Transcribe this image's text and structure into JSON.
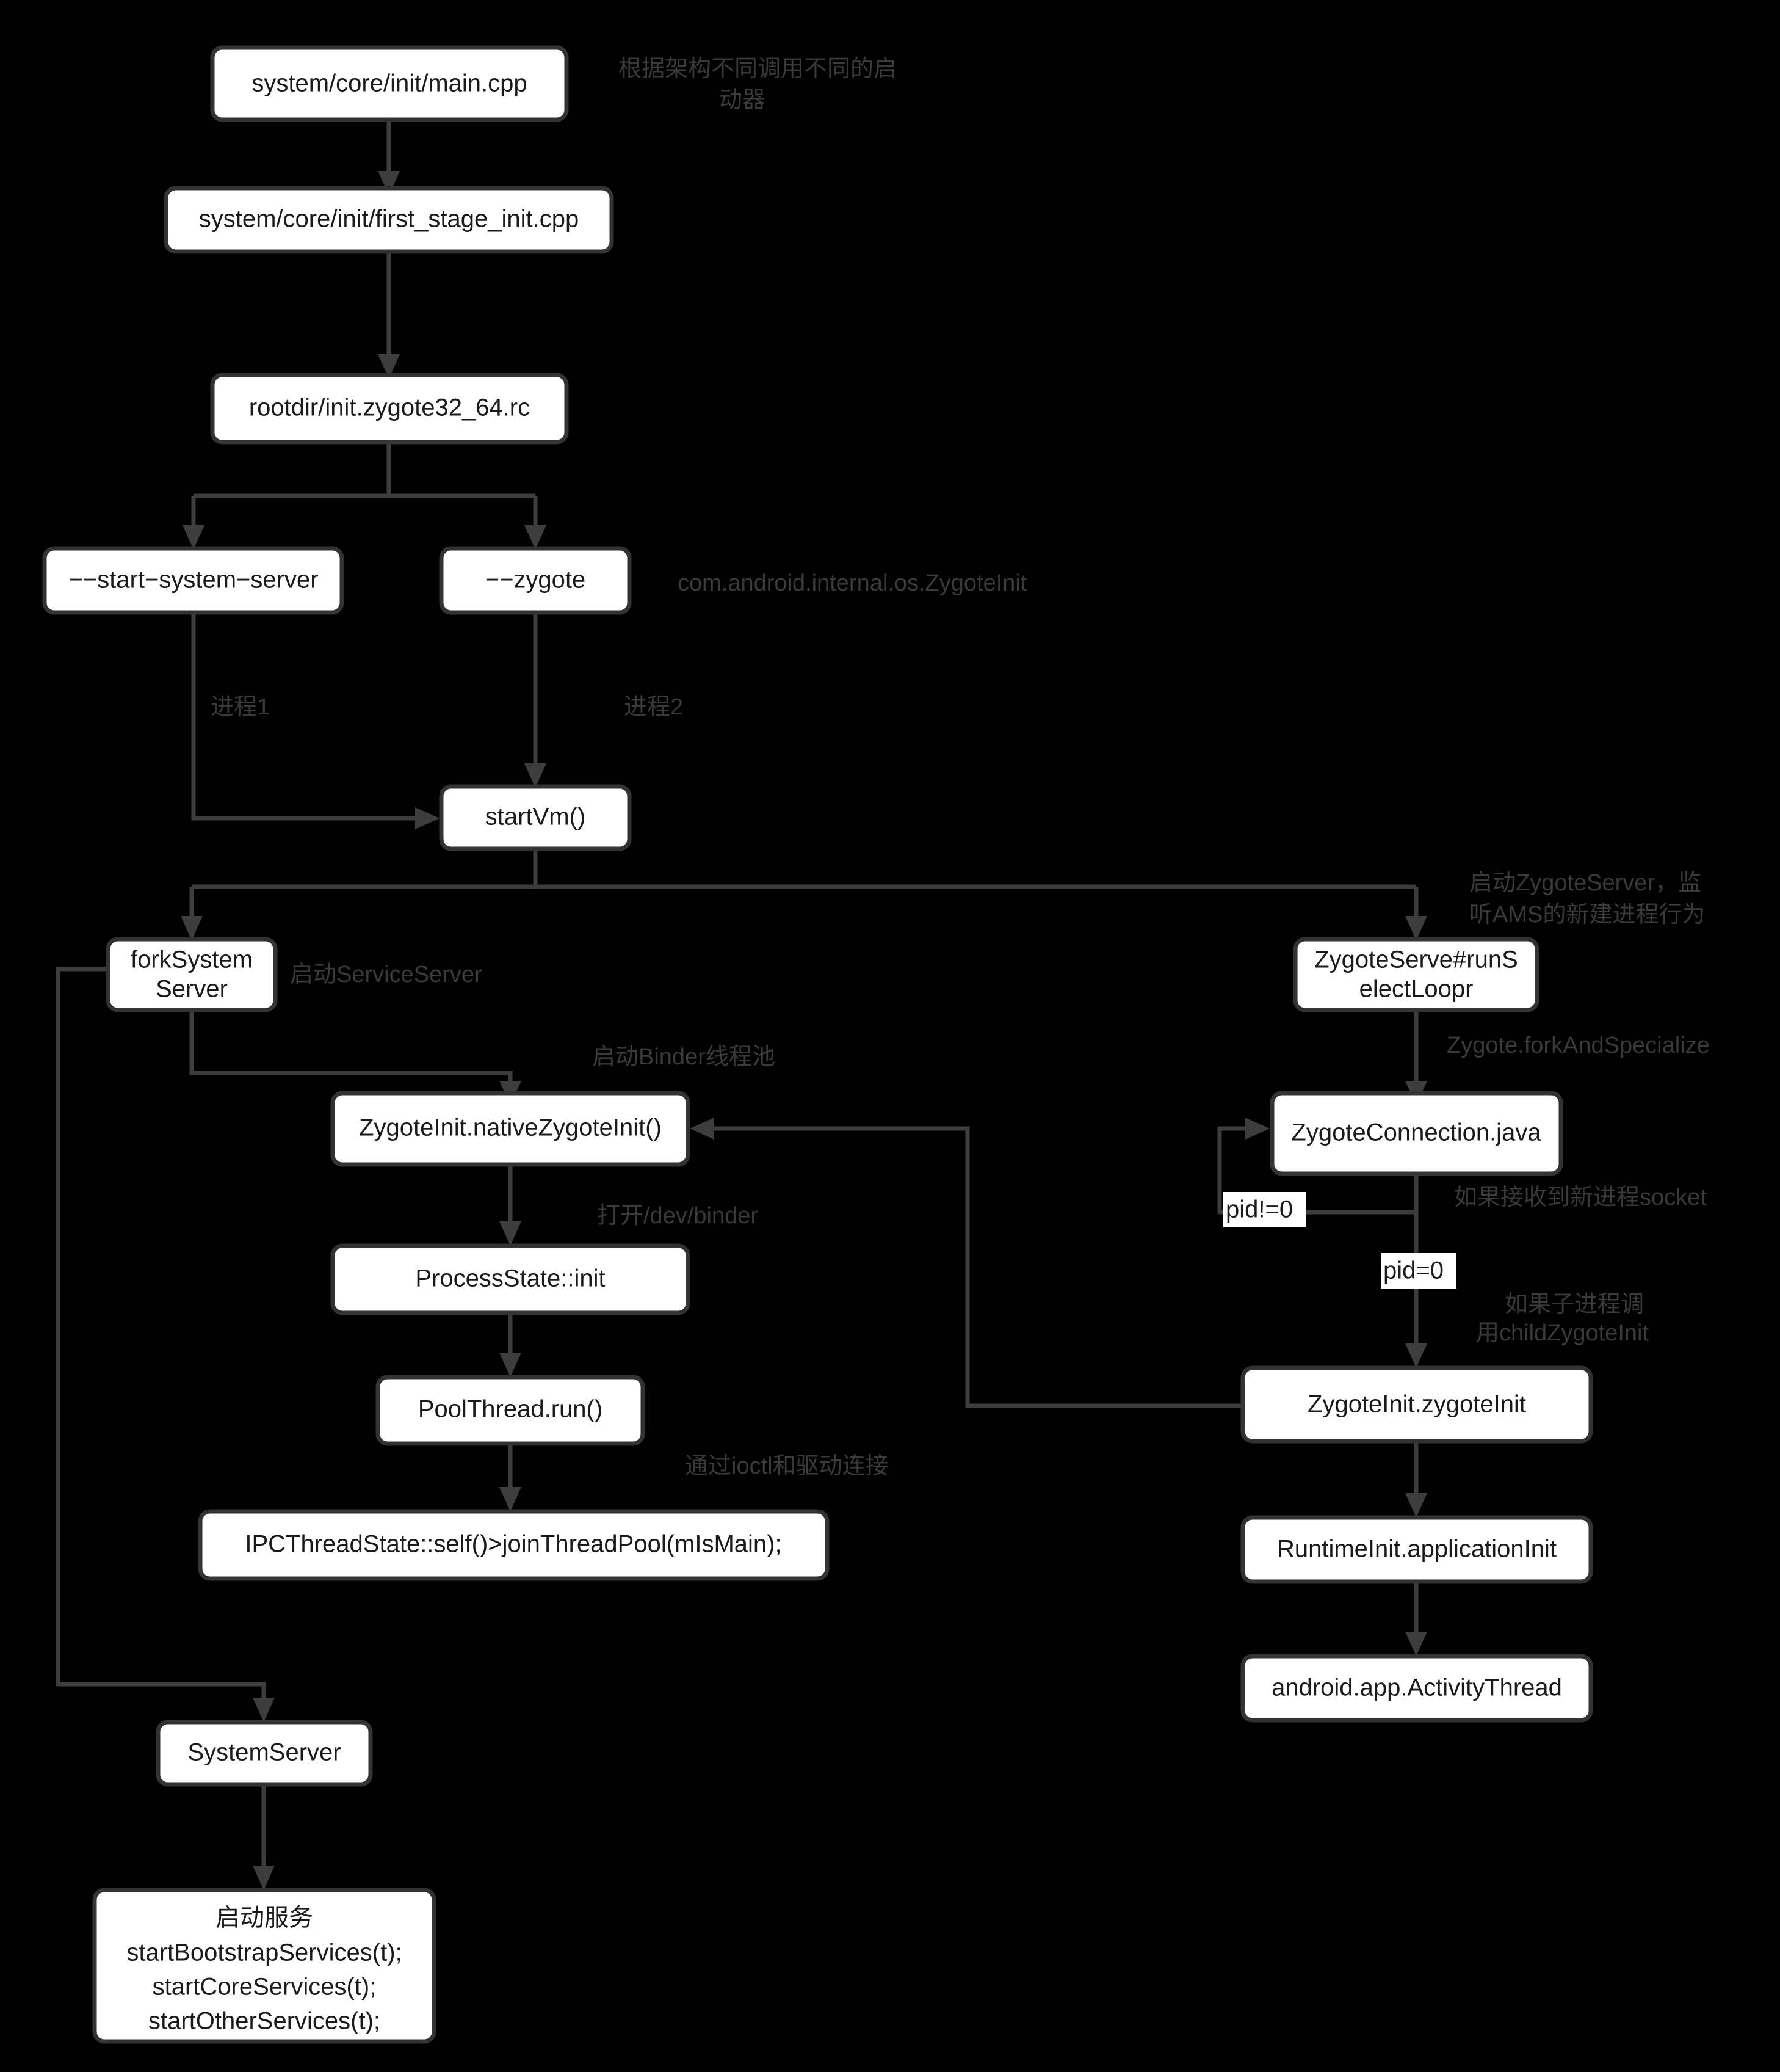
{
  "diagram": {
    "title": "Android Zygote / SystemServer startup flow",
    "background_color": "#000000",
    "node_fill": "#ffffff",
    "node_border": "#333333",
    "edge_color": "#3d3d3d",
    "edge_label_color": "#3a3a3a"
  },
  "nodes": {
    "main_cpp": {
      "label": "system/core/init/main.cpp"
    },
    "first_stage_init": {
      "label": "system/core/init/first_stage_init.cpp"
    },
    "zygote_rc": {
      "label": "rootdir/init.zygote32_64.rc"
    },
    "start_system_server": {
      "label": "−−start−system−server"
    },
    "zygote_arg": {
      "label": "−−zygote"
    },
    "start_vm": {
      "label": "startVm()"
    },
    "fork_system_server_l1": {
      "label": "forkSystem"
    },
    "fork_system_server_l2": {
      "label": "Server"
    },
    "zygote_server_loop_l1": {
      "label": "ZygoteServe#runS"
    },
    "zygote_server_loop_l2": {
      "label": "electLoopr"
    },
    "native_zygote_init": {
      "label": "ZygoteInit.nativeZygoteInit()"
    },
    "zygote_connection": {
      "label": "ZygoteConnection.java"
    },
    "process_state_init": {
      "label": "ProcessState::init"
    },
    "pool_thread_run": {
      "label": "PoolThread.run()"
    },
    "zygote_init_zygote_init": {
      "label": "ZygoteInit.zygoteInit"
    },
    "ipc_thread_state": {
      "label": "IPCThreadState::self()>joinThreadPool(mIsMain);"
    },
    "runtime_init": {
      "label": "RuntimeInit.applicationInit"
    },
    "activity_thread": {
      "label": "android.app.ActivityThread"
    },
    "system_server": {
      "label": "SystemServer"
    },
    "start_services_l1": {
      "label": "启动服务"
    },
    "start_services_l2": {
      "label": "startBootstrapServices(t);"
    },
    "start_services_l3": {
      "label": "startCoreServices(t);"
    },
    "start_services_l4": {
      "label": "startOtherServices(t);"
    }
  },
  "edge_labels": {
    "arch_launcher_l1": "根据架构不同调用不同的启",
    "arch_launcher_l2": "动器",
    "zygote_init_class": "com.android.internal.os.ZygoteInit",
    "process1": "进程1",
    "process2": "进程2",
    "start_zygote_server_l1": "启动ZygoteServer，监",
    "start_zygote_server_l2": "听AMS的新建进程行为",
    "start_service_server": "启动ServiceServer",
    "start_binder_pool": "启动Binder线程池",
    "fork_and_specialize": "Zygote.forkAndSpecialize",
    "open_dev_binder": "打开/dev/binder",
    "recv_new_process_socket": "如果接收到新进程socket",
    "child_zygote_init_l1": "如果子进程调",
    "child_zygote_init_l2": "用childZygoteInit",
    "ioctl_driver_connect": "通过ioctl和驱动连接"
  },
  "condition_labels": {
    "pid_not_zero": "pid!=0",
    "pid_zero": "pid=0"
  }
}
